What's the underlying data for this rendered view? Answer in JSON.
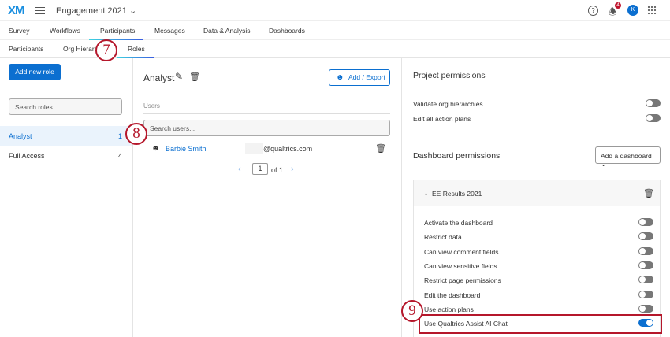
{
  "header": {
    "logo": "XM",
    "project": "Engagement 2021",
    "notifications": "4",
    "avatar": "K"
  },
  "nav": [
    "Survey",
    "Workflows",
    "Participants",
    "Messages",
    "Data & Analysis",
    "Dashboards"
  ],
  "subnav": [
    "Participants",
    "Org Hierarchies",
    "Roles"
  ],
  "left": {
    "add_role": "Add new role",
    "search_placeholder": "Search roles...",
    "roles": [
      {
        "name": "Analyst",
        "count": "1"
      },
      {
        "name": "Full Access",
        "count": "4"
      }
    ]
  },
  "mid": {
    "title": "Analyst",
    "add_export": "Add / Export",
    "users_label": "Users",
    "search_placeholder": "Search users...",
    "users": [
      {
        "name": "Barbie Smith",
        "email": "@qualtrics.com"
      }
    ],
    "page": "1",
    "of": "of 1"
  },
  "right": {
    "project_title": "Project permissions",
    "project_perms": [
      {
        "label": "Validate org hierarchies",
        "on": false
      },
      {
        "label": "Edit all action plans",
        "on": false
      }
    ],
    "dashboard_title": "Dashboard permissions",
    "add_dashboard": "Add a dashboard",
    "dashboard_name": "EE Results 2021",
    "dashboard_perms": [
      {
        "label": "Activate the dashboard",
        "on": false
      },
      {
        "label": "Restrict data",
        "on": false
      },
      {
        "label": "Can view comment fields",
        "on": false
      },
      {
        "label": "Can view sensitive fields",
        "on": false
      },
      {
        "label": "Restrict page permissions",
        "on": false
      },
      {
        "label": "Edit the dashboard",
        "on": false
      },
      {
        "label": "Use action plans",
        "on": false
      },
      {
        "label": "Use Qualtrics Assist AI Chat",
        "on": true
      }
    ]
  },
  "callouts": [
    "7",
    "8",
    "9"
  ],
  "colors": {
    "accent": "#0b6fd0",
    "callout": "#b5172b"
  }
}
